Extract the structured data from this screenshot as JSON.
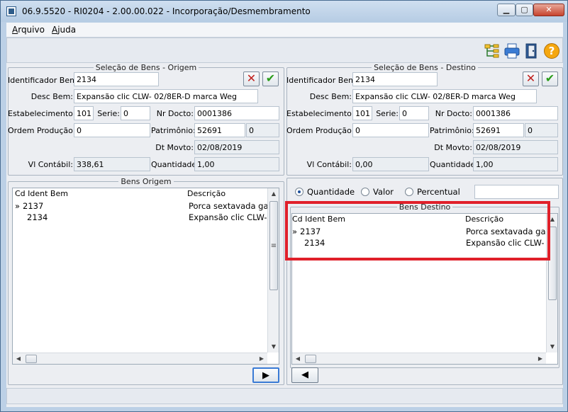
{
  "window": {
    "title": "06.9.5520 - RI0204 - 2.00.00.022 - Incorporação/Desmembramento",
    "min_glyph": "▁",
    "max_glyph": "▢",
    "close_glyph": "✕"
  },
  "menu": {
    "arquivo_first": "A",
    "arquivo_rest": "rquivo",
    "ajuda_first": "A",
    "ajuda_rest": "juda"
  },
  "toolbar": {
    "icons": [
      "tree-hierarchy-icon",
      "printer-icon",
      "exit-door-icon",
      "help-icon"
    ],
    "help_glyph": "?"
  },
  "origem": {
    "legend": "Seleção de Bens - Origem",
    "identificador_label": "Identificador Bem:",
    "identificador_value": "2134",
    "desc_label": "Desc Bem:",
    "desc_value": "Expansão clic CLW- 02/8ER-D marca Weg",
    "estab_label": "Estabelecimento:",
    "estab_value": "101",
    "serie_label": "Serie:",
    "serie_value": "0",
    "nrdocto_label": "Nr Docto:",
    "nrdocto_value": "0001386",
    "ordem_label": "Ordem Produção:",
    "ordem_value": "0",
    "patrimonio_label": "Patrimônio:",
    "patrimonio_value": "52691",
    "patrimonio_seq": "0",
    "dtmovto_label": "Dt Movto:",
    "dtmovto_value": "02/08/2019",
    "vlcontabil_label": "Vl Contábil:",
    "vlcontabil_value": "338,61",
    "quantidade_label": "Quantidade:",
    "quantidade_value": "1,00"
  },
  "destino": {
    "legend": "Seleção de Bens - Destino",
    "identificador_label": "Identificador Bem:",
    "identificador_value": "2134",
    "desc_label": "Desc Bem:",
    "desc_value": "Expansão clic CLW- 02/8ER-D marca Weg",
    "estab_label": "Estabelecimento:",
    "estab_value": "101",
    "serie_label": "Serie:",
    "serie_value": "0",
    "nrdocto_label": "Nr Docto:",
    "nrdocto_value": "0001386",
    "ordem_label": "Ordem Produção:",
    "ordem_value": "0",
    "patrimonio_label": "Patrimônio:",
    "patrimonio_value": "52691",
    "patrimonio_seq": "0",
    "dtmovto_label": "Dt Movto:",
    "dtmovto_value": "02/08/2019",
    "vlcontabil_label": "Vl Contábil:",
    "vlcontabil_value": "0,00",
    "quantidade_label": "Quantidade:",
    "quantidade_value": "1,00"
  },
  "buttons": {
    "cancel_glyph": "✕",
    "confirm_glyph": "✔",
    "move_right_glyph": "▶",
    "move_left_glyph": "◀"
  },
  "bens_origem": {
    "legend": "Bens Origem",
    "col_cd": "Cd Ident Bem",
    "col_desc": "Descrição",
    "rows": [
      {
        "marker": "»",
        "cd": "2137",
        "desc": "Porca sextavada ga"
      },
      {
        "marker": "",
        "cd": "2134",
        "desc": "Expansão clic CLW-"
      }
    ]
  },
  "rateio": {
    "quantidade": "Quantidade",
    "valor": "Valor",
    "percentual": "Percentual",
    "selected": "quantidade",
    "value": ""
  },
  "bens_destino": {
    "legend": "Bens Destino",
    "col_cd": "Cd Ident Bem",
    "col_desc": "Descrição",
    "rows": [
      {
        "marker": "»",
        "cd": "2137",
        "desc": "Porca sextavada ga"
      },
      {
        "marker": "",
        "cd": "2134",
        "desc": "Expansão clic CLW-"
      }
    ]
  },
  "scroll_glyphs": {
    "up": "▲",
    "down": "▼",
    "left": "◀",
    "right": "▶",
    "grip": "≡"
  },
  "colors": {
    "highlight": "#e0202a",
    "window_frame": "#bcd0e6",
    "client_bg": "#eceef2"
  }
}
